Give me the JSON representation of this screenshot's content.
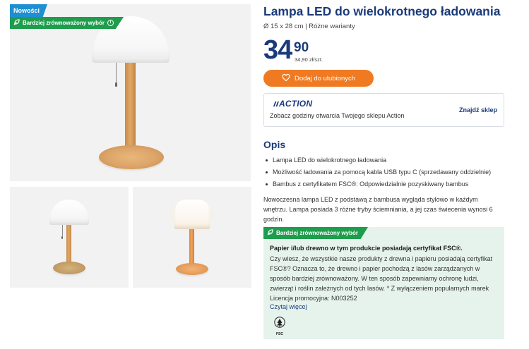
{
  "badges": {
    "new": "Nowości",
    "eco": "Bardziej zrównoważony wybór"
  },
  "product": {
    "title": "Lampa LED do wielokrotnego ładowania",
    "subtitle": "Ø 15 x 28 cm | Różne warianty",
    "price_main": "34",
    "price_cents": "90",
    "price_unit": "34,90 zł/szt.",
    "favorite_button": "Dodaj do ulubionych"
  },
  "store": {
    "logo": "ACTION",
    "text": "Zobacz godziny otwarcia Twojego sklepu Action",
    "link": "Znajdź sklep"
  },
  "description": {
    "title": "Opis",
    "bullets": [
      "Lampa LED do wielokrotnego ładowania",
      "Możliwość ładowania za pomocą kabla USB typu C (sprzedawany oddzielnie)",
      "Bambus z certyfikatem FSC®: Odpowiedzialnie pozyskiwany bambus"
    ],
    "paragraph": "Nowoczesna lampa LED z podstawą z bambusa wygląda stylowo w każdym wnętrzu. Lampa posiada 3 różne tryby ściemniania, a jej czas świecenia wynosi 6 godzin."
  },
  "eco": {
    "badge": "Bardziej zrównoważony wybór",
    "heading": "Papier i/lub drewno w tym produkcie posiadają certyfikat FSC®.",
    "text": "Czy wiesz, że wszystkie nasze produkty z drewna i papieru posiadają certyfikat FSC®? Oznacza to, że drewno i papier pochodzą z lasów zarządzanych w sposób bardziej zrównoważony. W ten sposób zapewniamy ochronę ludzi, zwierząt i roślin zależnych od tych lasów. * Z wyłączeniem popularnych marek Licencja promocyjna: N003252",
    "link": "Czytaj więcej",
    "fsc_label": "FSC"
  },
  "colors": {
    "brand_blue": "#1a3a7a",
    "accent_orange": "#f07a22",
    "eco_green": "#1e9d4c",
    "new_badge_blue": "#1e8fd1",
    "eco_box_bg": "#e6f3ec"
  },
  "icons": {
    "heart": "heart-icon",
    "leaf": "leaf-icon",
    "info": "info-icon",
    "fsc": "fsc-tree-icon"
  }
}
